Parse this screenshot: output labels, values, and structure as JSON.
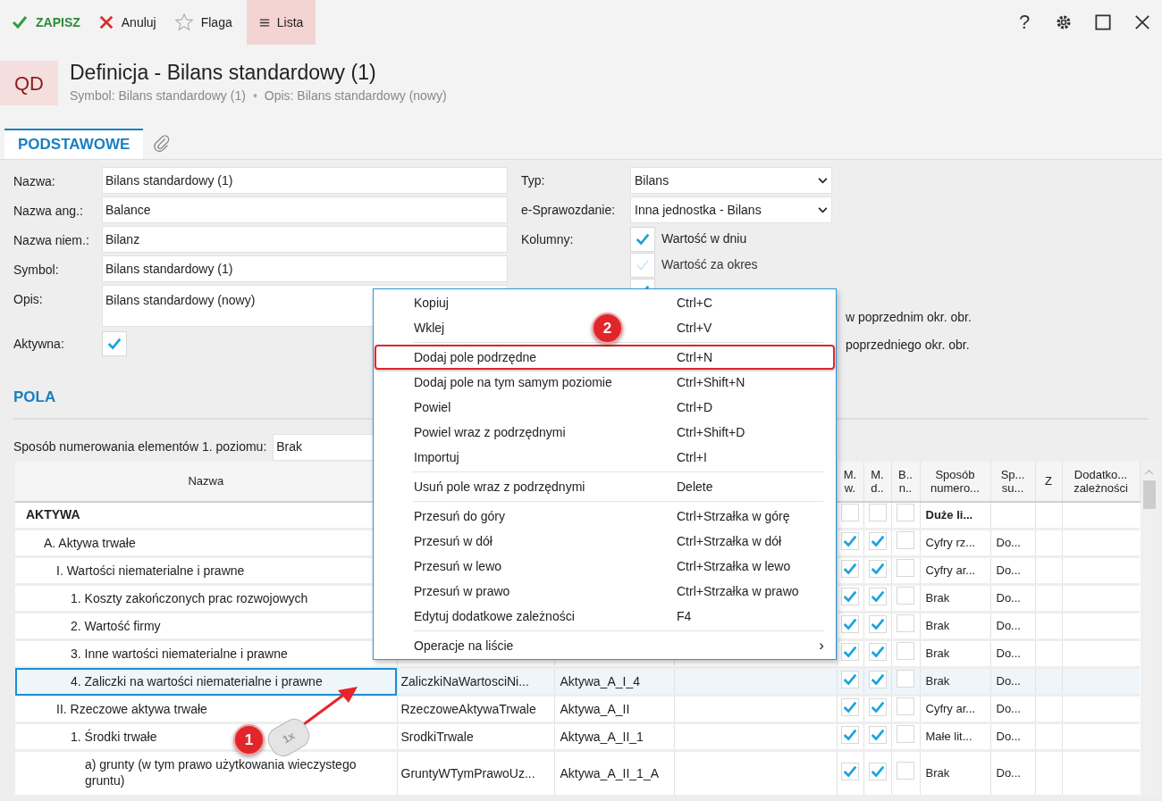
{
  "toolbar": {
    "buttons": [
      {
        "kind": "save",
        "label": "ZAPISZ",
        "selected": false
      },
      {
        "kind": "cancel",
        "label": "Anuluj",
        "selected": false
      },
      {
        "kind": "flag",
        "label": "Flaga",
        "selected": false
      },
      {
        "kind": "list",
        "label": "Lista",
        "selected": true
      }
    ],
    "help_label": "?"
  },
  "header": {
    "badge": "QD",
    "title": "Definicja - Bilans standardowy (1)",
    "subtitle": [
      "Symbol: Bilans standardowy (1)",
      "Opis: Bilans standardowy (nowy)"
    ],
    "separator": "•"
  },
  "tabs": [
    {
      "label": "PODSTAWOWE",
      "selected": true
    },
    {
      "kind": "attachment",
      "selected": false
    }
  ],
  "form": {
    "left": [
      {
        "label": "Nazwa:",
        "value": "Bilans standardowy (1)",
        "kind": "text"
      },
      {
        "label": "Nazwa ang.:",
        "value": "Balance",
        "kind": "text"
      },
      {
        "label": "Nazwa niem.:",
        "value": "Bilanz",
        "kind": "text"
      },
      {
        "label": "Symbol:",
        "value": "Bilans standardowy (1)",
        "kind": "text"
      },
      {
        "label": "Opis:",
        "value": "Bilans standardowy (nowy)",
        "kind": "textarea"
      },
      {
        "label": "Aktywna:",
        "checked": true,
        "kind": "checkbox"
      }
    ],
    "right": [
      {
        "label": "Typ:",
        "value": "Bilans"
      },
      {
        "label": "e-Sprawozdanie:",
        "value": "Inna jednostka - Bilans"
      }
    ],
    "columns_label": "Kolumny:",
    "columns": [
      {
        "kind": "checkbox",
        "label": "Wartość w dniu",
        "checked": true,
        "disabled": false
      },
      {
        "kind": "checkbox",
        "label": "Wartość za okres",
        "checked": true,
        "disabled": true
      },
      {
        "kind": "checkbox",
        "checked": true,
        "disabled": false
      },
      {
        "kind": "fragment",
        "label": "w poprzednim okr. obr."
      },
      {
        "kind": "fragment",
        "label": "poprzedniego okr. obr."
      }
    ]
  },
  "section": {
    "title": "POLA",
    "numbering_label": "Sposób numerowania elementów 1. poziomu:",
    "numbering_value": "Brak"
  },
  "table": {
    "columns": [
      "Nazwa",
      "",
      "",
      "",
      "M. w.",
      "M. d..",
      "B.. n..",
      "Sposób numero...",
      "Sp... su...",
      "Z",
      "Dodatko... zależności"
    ],
    "rows": [
      {
        "name": "AKTYWA",
        "bold": true,
        "mw": false,
        "md": false,
        "bn": false,
        "numbering": "Duże li...",
        "selected": false
      },
      {
        "name": "A. Aktywa trwałe",
        "mw": true,
        "md": true,
        "bn": false,
        "numbering": "Cyfry rz...",
        "sp": "Do...",
        "selected": false
      },
      {
        "name": "I. Wartości niematerialne i prawne",
        "mw": true,
        "md": true,
        "bn": false,
        "numbering": "Cyfry ar...",
        "sp": "Do...",
        "selected": false
      },
      {
        "name": "1. Koszty zakończonych prac rozwojowych",
        "mw": true,
        "md": true,
        "bn": false,
        "numbering": "Brak",
        "sp": "Do...",
        "selected": false
      },
      {
        "name": "2. Wartość firmy",
        "mw": true,
        "md": true,
        "bn": false,
        "numbering": "Brak",
        "sp": "Do...",
        "selected": false
      },
      {
        "name": "3. Inne wartości niematerialne i prawne",
        "mw": true,
        "md": true,
        "bn": false,
        "numbering": "Brak",
        "sp": "Do...",
        "selected": false
      },
      {
        "name": "4. Zaliczki na wartości niematerialne i prawne",
        "code": "ZaliczkiNaWartosciNi...",
        "symbol": "Aktywa_A_I_4",
        "mw": true,
        "md": true,
        "bn": false,
        "numbering": "Brak",
        "sp": "Do...",
        "selected": true
      },
      {
        "name": "II. Rzeczowe aktywa trwałe",
        "code": "RzeczoweAktywaTrwale",
        "symbol": "Aktywa_A_II",
        "mw": true,
        "md": true,
        "bn": false,
        "numbering": "Cyfry ar...",
        "sp": "Do...",
        "selected": false
      },
      {
        "name": "1. Środki trwałe",
        "code": "SrodkiTrwale",
        "symbol": "Aktywa_A_II_1",
        "mw": true,
        "md": true,
        "bn": false,
        "numbering": "Małe lit...",
        "sp": "Do...",
        "selected": false
      },
      {
        "name": "a) grunty (w tym prawo użytkowania wieczystego gruntu)",
        "code": "GruntyWTymPrawoUz...",
        "symbol": "Aktywa_A_II_1_A",
        "mw": true,
        "md": true,
        "bn": false,
        "numbering": "Brak",
        "sp": "Do...",
        "selected": false
      }
    ]
  },
  "context_menu": {
    "groups": [
      [
        {
          "label": "Kopiuj",
          "shortcut": "Ctrl+C",
          "highlighted": false
        },
        {
          "label": "Wklej",
          "shortcut": "Ctrl+V",
          "highlighted": false
        }
      ],
      [
        {
          "label": "Dodaj pole podrzędne",
          "shortcut": "Ctrl+N",
          "highlighted": true
        },
        {
          "label": "Dodaj pole na tym samym poziomie",
          "shortcut": "Ctrl+Shift+N",
          "highlighted": false
        },
        {
          "label": "Powiel",
          "shortcut": "Ctrl+D",
          "highlighted": false
        },
        {
          "label": "Powiel wraz z podrzędnymi",
          "shortcut": "Ctrl+Shift+D",
          "highlighted": false
        },
        {
          "label": "Importuj",
          "shortcut": "Ctrl+I",
          "highlighted": false
        }
      ],
      [
        {
          "label": "Usuń pole wraz z podrzędnymi",
          "shortcut": "Delete",
          "highlighted": false
        }
      ],
      [
        {
          "label": "Przesuń do góry",
          "shortcut": "Ctrl+Strzałka w górę",
          "highlighted": false
        },
        {
          "label": "Przesuń w dół",
          "shortcut": "Ctrl+Strzałka w dół",
          "highlighted": false
        },
        {
          "label": "Przesuń w lewo",
          "shortcut": "Ctrl+Strzałka w lewo",
          "highlighted": false
        },
        {
          "label": "Przesuń w prawo",
          "shortcut": "Ctrl+Strzałka w prawo",
          "highlighted": false
        },
        {
          "label": "Edytuj dodatkowe zależności",
          "shortcut": "F4",
          "highlighted": false
        }
      ],
      [
        {
          "label": "Operacje na liście",
          "submenu": "›",
          "highlighted": false
        }
      ]
    ]
  },
  "annotations": {
    "step_1": "1",
    "step_2": "2",
    "mouse_label": "1x"
  }
}
